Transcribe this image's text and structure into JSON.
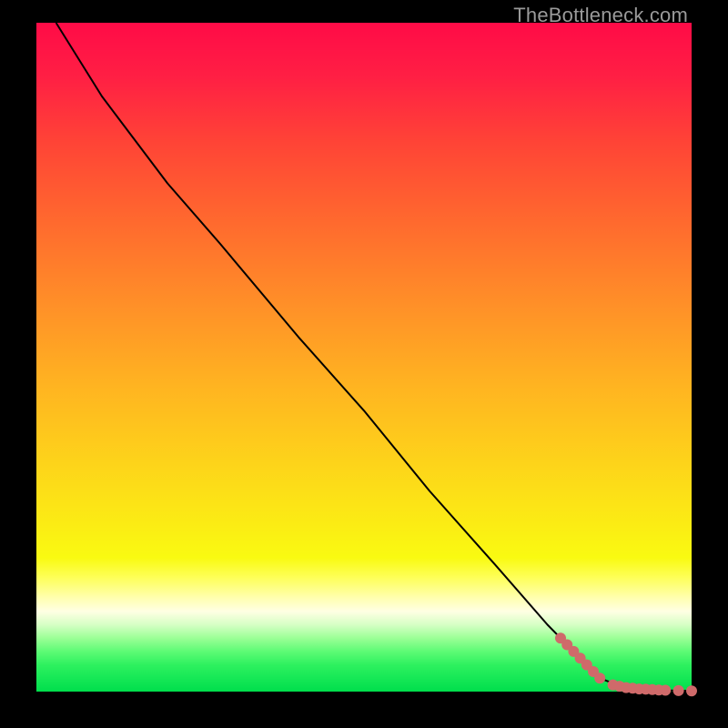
{
  "watermark": "TheBottleneck.com",
  "colors": {
    "dot": "#cf6a6a",
    "curve": "#000000"
  },
  "chart_data": {
    "type": "line",
    "title": "",
    "xlabel": "",
    "ylabel": "",
    "xlim": [
      0,
      100
    ],
    "ylim": [
      0,
      100
    ],
    "grid": false,
    "legend": false,
    "background": "gradient-red-to-green",
    "series": [
      {
        "name": "curve",
        "style": "line",
        "x": [
          3,
          10,
          20,
          28,
          40,
          50,
          60,
          70,
          78,
          84,
          86,
          90,
          95,
          100
        ],
        "y": [
          100,
          89,
          76,
          67,
          53,
          42,
          30,
          19,
          10,
          4,
          2,
          0.5,
          0.2,
          0.1
        ]
      },
      {
        "name": "tail-points",
        "style": "scatter",
        "x": [
          80,
          81,
          82,
          83,
          84,
          85,
          86,
          88,
          89,
          90,
          91,
          92,
          93,
          94,
          95,
          96,
          98,
          100
        ],
        "y": [
          8,
          7,
          6,
          5,
          4,
          3,
          2,
          1,
          0.8,
          0.6,
          0.5,
          0.4,
          0.35,
          0.3,
          0.25,
          0.2,
          0.15,
          0.1
        ]
      }
    ]
  }
}
